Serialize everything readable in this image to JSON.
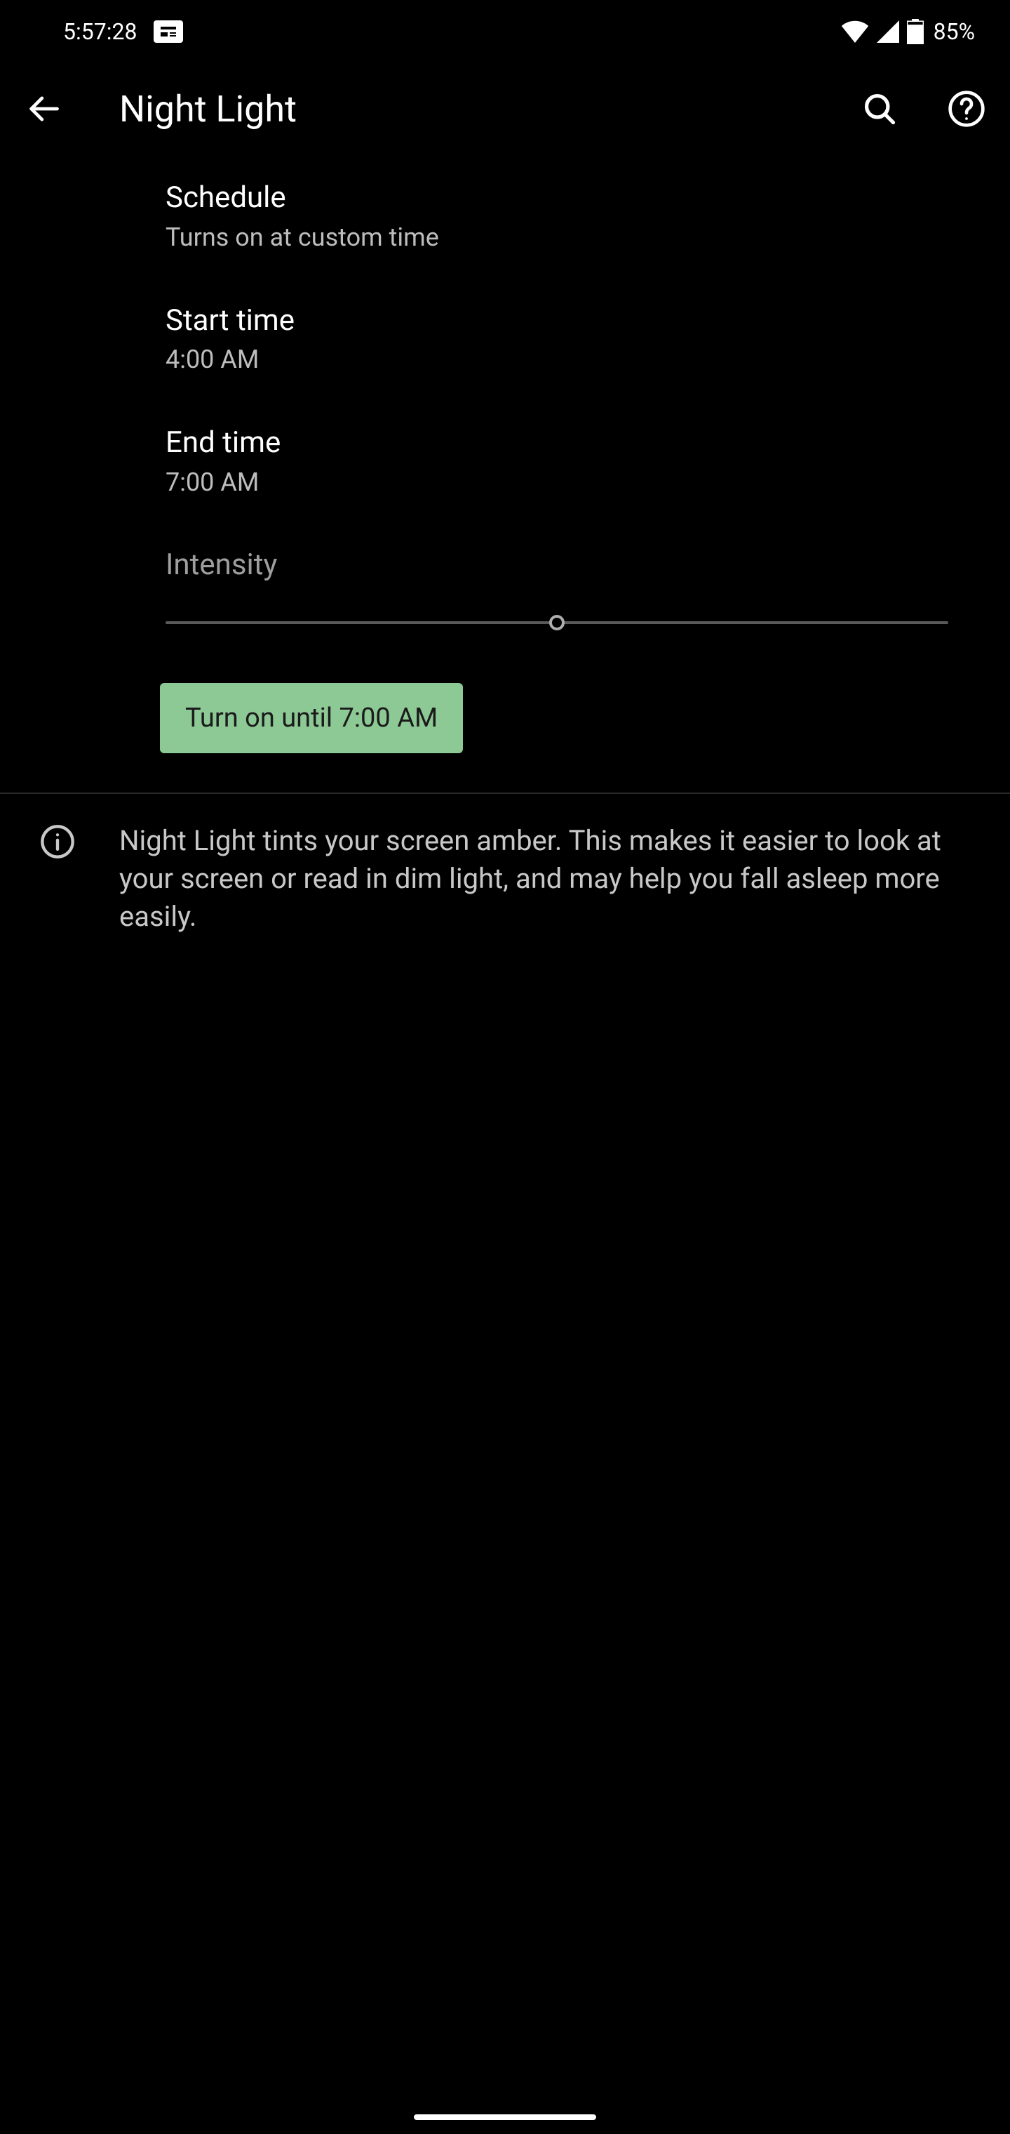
{
  "status": {
    "time": "5:57:28",
    "battery": "85%"
  },
  "header": {
    "title": "Night Light"
  },
  "settings": {
    "schedule": {
      "title": "Schedule",
      "subtitle": "Turns on at custom time"
    },
    "start_time": {
      "title": "Start time",
      "value": "4:00 AM"
    },
    "end_time": {
      "title": "End time",
      "value": "7:00 AM"
    },
    "intensity": {
      "label": "Intensity",
      "value_pct": 50
    }
  },
  "actions": {
    "turn_on_label": "Turn on until 7:00 AM"
  },
  "info": {
    "text": "Night Light tints your screen amber. This makes it easier to look at your screen or read in dim light, and may help you fall asleep more easily."
  }
}
